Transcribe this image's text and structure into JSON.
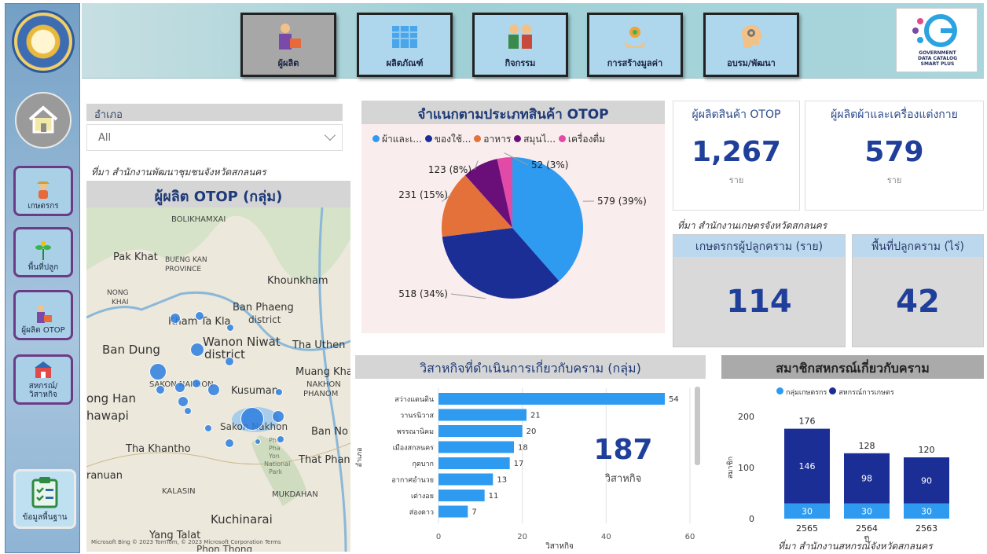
{
  "tabs": [
    {
      "label": "ผู้ผลิต",
      "active": true,
      "icon": "producer-icon"
    },
    {
      "label": "ผลิตภัณฑ์",
      "active": false,
      "icon": "product-icon"
    },
    {
      "label": "กิจกรรม",
      "active": false,
      "icon": "activity-icon"
    },
    {
      "label": "การสร้างมูลค่า",
      "active": false,
      "icon": "value-creation-icon"
    },
    {
      "label": "อบรม/พัฒนา",
      "active": false,
      "icon": "training-icon"
    }
  ],
  "gov_logo": {
    "line1": "GOVERNMENT",
    "line2": "DATA CATALOG",
    "line3": "SMART PLUS"
  },
  "sidebar": {
    "items": [
      {
        "label": "เกษตรกร",
        "icon": "farmer-icon"
      },
      {
        "label": "พื้นที่ปลูก",
        "icon": "plant-area-icon"
      },
      {
        "label": "ผู้ผลิต OTOP",
        "icon": "otop-producer-icon"
      },
      {
        "label": "สหกรณ์/วิสาหกิจ",
        "icon": "cooperative-icon"
      }
    ],
    "info_label": "ข้อมูลพื้นฐาน"
  },
  "filter": {
    "label": "อำเภอ",
    "value": "All"
  },
  "sources": {
    "community": "ที่มา สำนักงานพัฒนาชุมชนจังหวัดสกลนคร",
    "agri": "ที่มา สำนักงานเกษตรจังหวัดสกลนคร",
    "coop": "ที่มา สำนักงานสหกรณ์จังหวัดสกลนคร"
  },
  "map": {
    "title": "ผู้ผลิต OTOP (กลุ่ม)",
    "labels": [
      "BOLIKHAMXAI",
      "Pak Khat",
      "BUENG KAN",
      "PROVINCE",
      "Khounkham",
      "NONG",
      "KHAI",
      "Ban Phaeng",
      "district",
      "Kham Ta Kla",
      "Wanon Niwat",
      "district",
      "Tha Uthen",
      "Ban Dung",
      "Muang Kha",
      "NAKHON",
      "PHANOM",
      "SAKON NAKHON",
      "Kusuman",
      "ong Han",
      "hawapi",
      "Sakon Nakhon",
      "Ban No",
      "Tha Khantho",
      "Phu",
      "Pha",
      "Yon",
      "National",
      "Park",
      "That Phan",
      "ranuan",
      "KALASIN",
      "MUKDAHAN",
      "Kuchinarai",
      "Yang Talat",
      "Phon Thong"
    ],
    "attribution": "Microsoft Bing   © 2023 TomTom, © 2023 Microsoft Corporation  Terms"
  },
  "pie": {
    "title": "จำแนกตามประเภทสินค้า OTOP",
    "legend": [
      {
        "label": "ผ้าและเ...",
        "color": "#2e9bf0"
      },
      {
        "label": "ของใช้...",
        "color": "#1a2e96"
      },
      {
        "label": "อาหาร",
        "color": "#e5713a"
      },
      {
        "label": "สมุนไ...",
        "color": "#6a0f7a"
      },
      {
        "label": "เครื่องดื่ม",
        "color": "#e24aa8"
      }
    ]
  },
  "kpi": {
    "otop_title": "ผู้ผลิตสินค้า OTOP",
    "otop_value": "1,267",
    "otop_unit": "ราย",
    "textile_title": "ผู้ผลิตผ้าและเครื่องแต่งกาย",
    "textile_value": "579",
    "textile_unit": "ราย",
    "farmers_title": "เกษตรกรผู้ปลูกคราม (ราย)",
    "farmers_value": "114",
    "area_title": "พื้นที่ปลูกคราม (ไร่)",
    "area_value": "42"
  },
  "bar": {
    "title": "วิสาหกิจที่ดำเนินการเกี่ยวกับคราม (กลุ่ม)",
    "total_value": "187",
    "total_label": "วิสาหกิจ",
    "ylabel": "อำเภอ",
    "xlabel": "วิสาหกิจ"
  },
  "stack": {
    "title": "สมาชิกสหกรณ์เกี่ยวกับคราม",
    "legend": [
      {
        "label": "กลุ่มเกษตรกร",
        "color": "#2e9bf0"
      },
      {
        "label": "สหกรณ์การเกษตร",
        "color": "#1a2e96"
      }
    ],
    "ylabel": "สมาชิก",
    "xlabel": "ปี"
  },
  "chart_data": [
    {
      "type": "pie",
      "title": "จำแนกตามประเภทสินค้า OTOP",
      "categories": [
        "ผ้าและเ...",
        "ของใช้...",
        "อาหาร",
        "สมุนไ...",
        "เครื่องดื่ม"
      ],
      "values": [
        579,
        518,
        231,
        123,
        52
      ],
      "labels": [
        "579 (39%)",
        "518 (34%)",
        "231 (15%)",
        "123 (8%)",
        "52 (3%)"
      ],
      "colors": [
        "#2e9bf0",
        "#1a2e96",
        "#e5713a",
        "#6a0f7a",
        "#e24aa8"
      ]
    },
    {
      "type": "bar",
      "orientation": "horizontal",
      "title": "วิสาหกิจที่ดำเนินการเกี่ยวกับคราม (กลุ่ม)",
      "categories": [
        "สว่างแดนดิน",
        "วานรนิวาส",
        "พรรณานิคม",
        "เมืองสกลนคร",
        "กุดบาก",
        "อากาศอำนวย",
        "เต่างอย",
        "ส่องดาว"
      ],
      "values": [
        54,
        21,
        20,
        18,
        17,
        13,
        11,
        7
      ],
      "xlim": [
        0,
        60
      ],
      "xticks": [
        0,
        20,
        40,
        60
      ],
      "xlabel": "วิสาหกิจ",
      "ylabel": "อำเภอ",
      "color": "#2e9bf0"
    },
    {
      "type": "bar",
      "stacked": true,
      "title": "สมาชิกสหกรณ์เกี่ยวกับคราม",
      "categories": [
        "2565",
        "2564",
        "2563"
      ],
      "series": [
        {
          "name": "กลุ่มเกษตรกร",
          "values": [
            30,
            30,
            30
          ],
          "color": "#2e9bf0"
        },
        {
          "name": "สหกรณ์การเกษตร",
          "values": [
            146,
            98,
            90
          ],
          "color": "#1a2e96"
        }
      ],
      "totals": [
        176,
        128,
        120
      ],
      "ylim": [
        0,
        200
      ],
      "yticks": [
        0,
        100,
        200
      ],
      "xlabel": "ปี",
      "ylabel": "สมาชิก"
    }
  ]
}
